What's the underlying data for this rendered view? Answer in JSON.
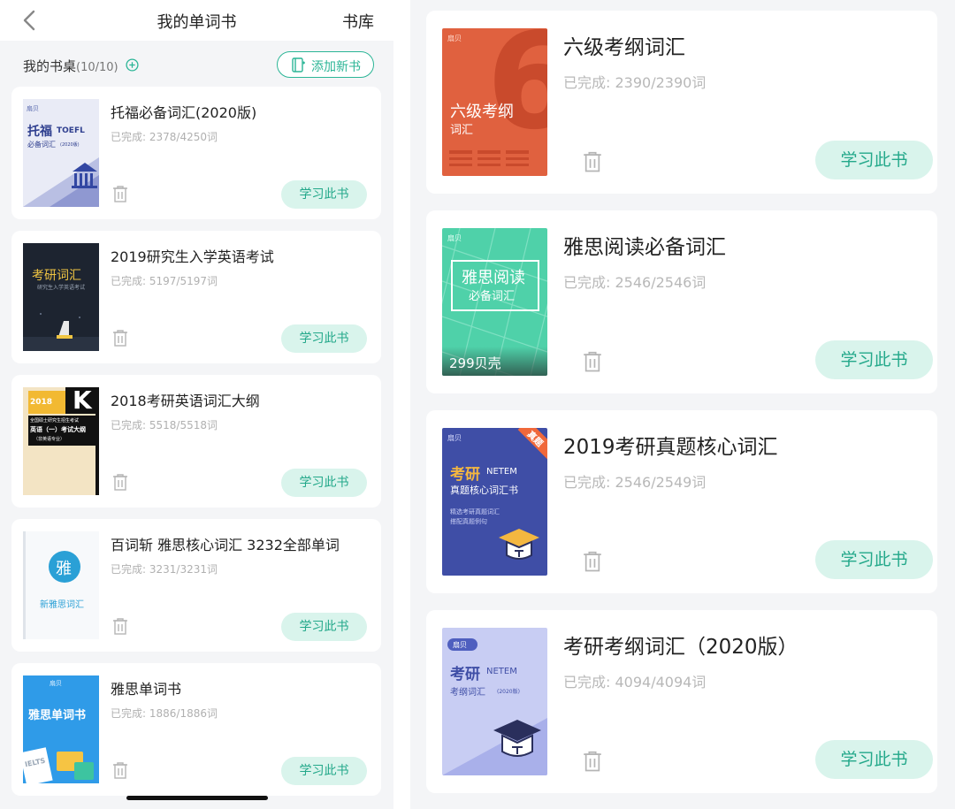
{
  "header": {
    "title": "我的单词书",
    "library_link": "书库"
  },
  "desk": {
    "label": "我的书桌",
    "count": "(10/10)",
    "add_button": "添加新书"
  },
  "study_label": "学习此书",
  "left_books": [
    {
      "name": "托福必备词汇(2020版)",
      "progress": "已完成: 2378/4250词",
      "cover": {
        "brand": "扇贝",
        "title": "托福",
        "subtitle": "必备词汇",
        "latin": "TOEFL",
        "edition": "(2020版)"
      }
    },
    {
      "name": "2019研究生入学英语考试",
      "progress": "已完成: 5197/5197词",
      "cover": {
        "title": "考研词汇",
        "subtitle": "研究生入学英语考试"
      }
    },
    {
      "name": "2018考研英语词汇大纲",
      "progress": "已完成: 5518/5518词",
      "cover": {
        "year": "2018",
        "big": "K",
        "line1": "全国硕士研究生招生考试",
        "line2": "英语（一）考试大纲",
        "line3": "（非英语专业）"
      }
    },
    {
      "name": "百词斩 雅思核心词汇 3232全部单词",
      "progress": "已完成: 3231/3231词",
      "cover": {
        "glyph": "雅",
        "title": "新雅思词汇"
      }
    },
    {
      "name": "雅思单词书",
      "progress": "已完成: 1886/1886词",
      "cover": {
        "brand": "扇贝",
        "title": "雅思单词书",
        "tag": "IELTS"
      }
    }
  ],
  "right_books": [
    {
      "name": "六级考纲词汇",
      "progress": "已完成: 2390/2390词",
      "cover": {
        "brand": "扇贝",
        "title": "六级考纲",
        "subtitle": "词汇",
        "big": "6"
      }
    },
    {
      "name": "雅思阅读必备词汇",
      "progress": "已完成: 2546/2546词",
      "cover": {
        "brand": "扇贝",
        "title": "雅思阅读",
        "subtitle": "必备词汇",
        "price": "299贝壳"
      }
    },
    {
      "name": "2019考研真题核心词汇",
      "progress": "已完成: 2546/2549词",
      "cover": {
        "brand": "扇贝",
        "title": "考研",
        "latin": "NETEM",
        "subtitle": "真题核心词汇书",
        "ribbon": "真题",
        "line1": "精选考研真题词汇",
        "line2": "搭配真题例句"
      }
    },
    {
      "name": "考研考纲词汇（2020版）",
      "progress": "已完成: 4094/4094词",
      "cover": {
        "brand": "扇贝",
        "title": "考研",
        "latin": "NETEM",
        "subtitle": "考纲词汇",
        "edition": "(2020版)"
      }
    }
  ],
  "colors": {
    "accent": "#2bb596",
    "study_bg": "#d9f4ec",
    "study_text": "#23a88a",
    "panel_bg": "#f4f5f7"
  }
}
